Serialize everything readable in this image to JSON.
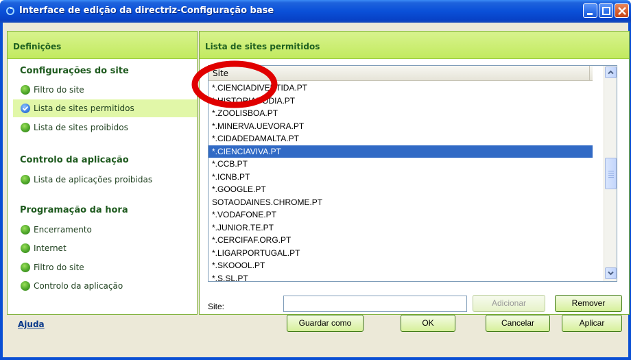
{
  "window": {
    "title": "Interface de edição da directriz-Configuração base"
  },
  "left_panel": {
    "header": "Definições",
    "sections": [
      {
        "title": "Configurações do site",
        "items": [
          "Filtro do site",
          "Lista de sites permitidos",
          "Lista de sites proibidos"
        ]
      },
      {
        "title": "Controlo da aplicação",
        "items": [
          "Lista de aplicações proibidas"
        ]
      },
      {
        "title": "Programação da hora",
        "items": [
          "Encerramento",
          "Internet",
          "Filtro do site",
          "Controlo da aplicação"
        ]
      }
    ],
    "selected_item": "Lista de sites permitidos"
  },
  "right_panel": {
    "header": "Lista de sites permitidos",
    "list": {
      "column_header": "Site",
      "rows": [
        "*.CIENCIADIVERTIDA.PT",
        "*.HISTORIADODIA.PT",
        "*.ZOOLISBOA.PT",
        "*.MINERVA.UEVORA.PT",
        "*.CIDADEDAMALTA.PT",
        "*.CIENCIAVIVA.PT",
        "*.CCB.PT",
        "*.ICNB.PT",
        "*.GOOGLE.PT",
        "SOTAODAINES.CHROME.PT",
        "*.VODAFONE.PT",
        "*.JUNIOR.TE.PT",
        "*.CERCIFAF.ORG.PT",
        "*.LIGARPORTUGAL.PT",
        "*.SKOOOL.PT",
        "*.S.SL.PT"
      ],
      "selected_row": "*.CIENCIAVIVA.PT"
    },
    "site_label": "Site:",
    "site_value": "",
    "add_button": "Adicionar",
    "remove_button": "Remover"
  },
  "footer": {
    "help_link": "Ajuda",
    "save_as_button": "Guardar como",
    "ok_button": "OK",
    "cancel_button": "Cancelar",
    "apply_button": "Aplicar"
  },
  "colors": {
    "title_bar": "#0a50d8",
    "panel_header": "#c2ea5f",
    "selection": "#316ac5",
    "annotation": "#e00000"
  }
}
